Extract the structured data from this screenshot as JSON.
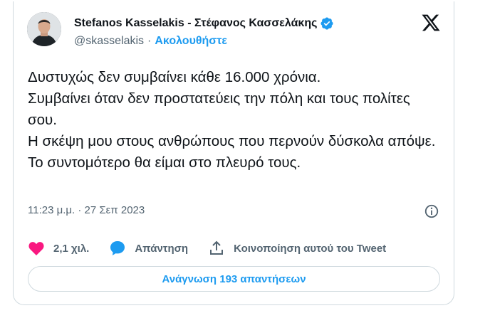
{
  "tweet": {
    "author_name": "Stefanos Kasselakis - Στέφανος Κασσελάκης",
    "handle": "@skasselakis",
    "separator": "·",
    "follow_label": "Ακολουθήστε",
    "text": "Δυστυχώς δεν συμβαίνει κάθε 16.000 χρόνια.\nΣυμβαίνει όταν δεν προστατεύεις την πόλη και τους πολίτες σου.\nΗ σκέψη μου στους ανθρώπους που περνούν δύσκολα απόψε.\nΤο συντομότερο θα είμαι στο πλευρό τους.",
    "timestamp": "11:23 μ.μ. · 27 Σεπ 2023"
  },
  "actions": {
    "likes_count": "2,1 χιλ.",
    "reply_label": "Απάντηση",
    "share_label": "Κοινοποίηση αυτού του Tweet"
  },
  "read_replies_label": "Ανάγνωση 193 απαντήσεων",
  "icons": {
    "verified": "verified-badge-icon",
    "platform": "x-logo-icon",
    "info": "info-icon",
    "like": "heart-icon",
    "reply": "speech-bubble-icon",
    "share": "share-upload-icon"
  },
  "colors": {
    "accent": "#1d9bf0",
    "like": "#f91880",
    "text": "#0f1419",
    "secondary": "#536471",
    "border": "#cfd9de"
  }
}
